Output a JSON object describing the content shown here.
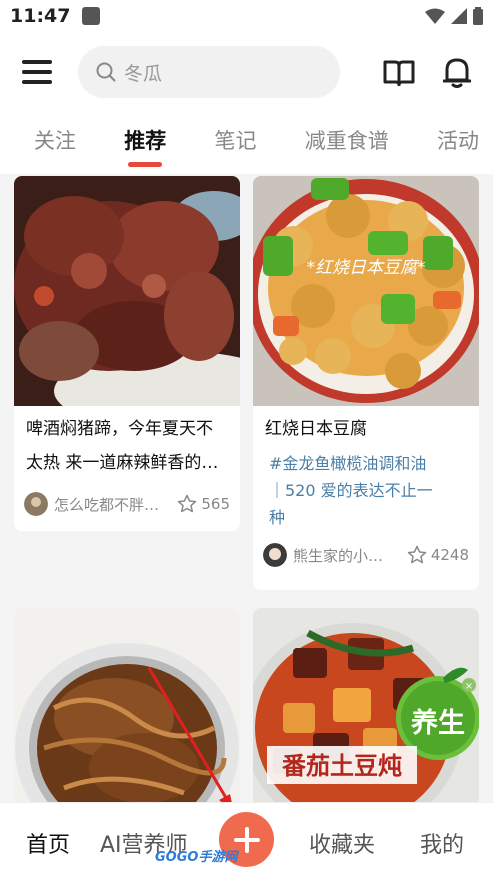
{
  "status": {
    "time": "11:47"
  },
  "search": {
    "placeholder": "冬瓜"
  },
  "tabs": [
    {
      "label": "关注"
    },
    {
      "label": "推荐"
    },
    {
      "label": "笔记"
    },
    {
      "label": "减重食谱"
    },
    {
      "label": "活动"
    }
  ],
  "cards": [
    {
      "title_line1": "啤酒焖猪蹄，今年夏天不",
      "title_line2": "太热 来一道麻辣鲜香的…",
      "author": "怎么吃都不胖…",
      "likes": "565"
    },
    {
      "title": "红烧日本豆腐",
      "image_caption": "*红烧日本豆腐*",
      "topic_line1": "#金龙鱼橄榄油调和油",
      "topic_line2": "｜520 爱的表达不止一",
      "topic_line3": "种",
      "author": "熊生家的小…",
      "likes": "4248"
    },
    {},
    {
      "image_caption_1": "番茄土豆炖",
      "image_caption_2": "养生"
    }
  ],
  "bottom_nav": {
    "home": "首页",
    "ai": "AI营养师",
    "favorites": "收藏夹",
    "mine": "我的"
  },
  "watermark": "GOGO手游网",
  "colors": {
    "accent": "#e8473b",
    "add_button": "#f06a4f",
    "topic": "#4a7fa8"
  }
}
